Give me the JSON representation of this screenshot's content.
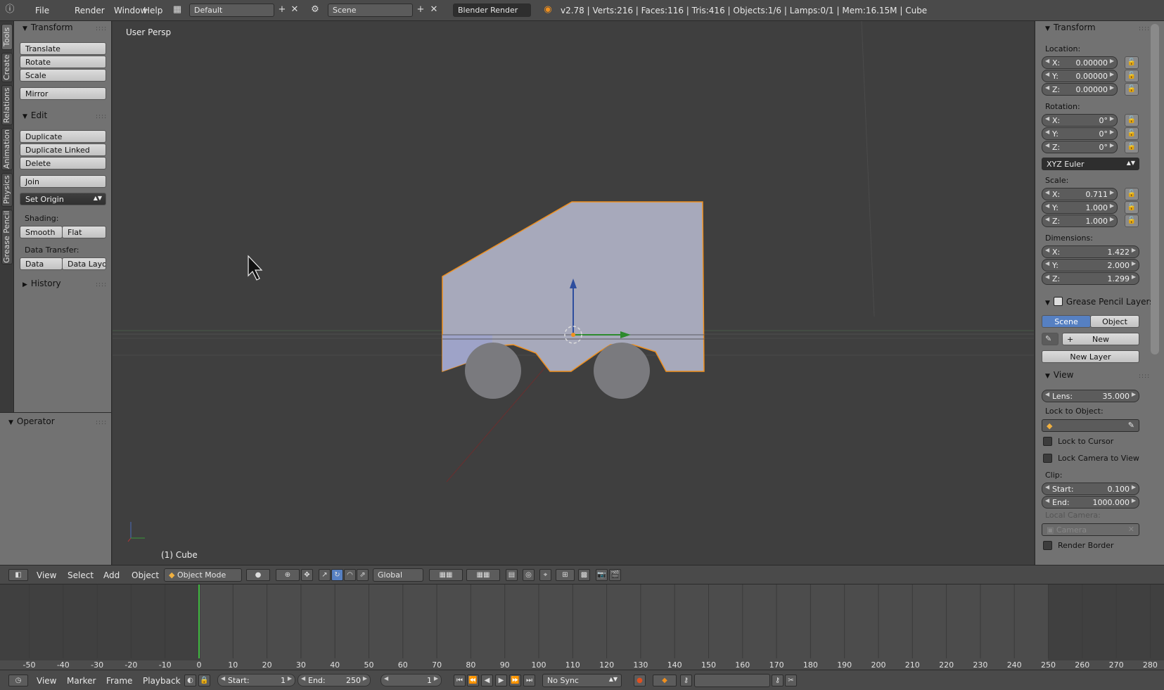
{
  "topbar": {
    "menus": [
      "File",
      "Render",
      "Window",
      "Help"
    ],
    "layout": "Default",
    "scene": "Scene",
    "engine": "Blender Render",
    "stats": "v2.78 | Verts:216 | Faces:116 | Tris:416 | Objects:1/6 | Lamps:0/1 | Mem:16.15M | Cube"
  },
  "left_tabs": [
    "Tools",
    "Create",
    "Relations",
    "Animation",
    "Physics",
    "Grease Pencil"
  ],
  "toolshelf": {
    "transform_title": "Transform",
    "transform_buttons": [
      "Translate",
      "Rotate",
      "Scale"
    ],
    "mirror": "Mirror",
    "edit_title": "Edit",
    "edit_buttons": [
      "Duplicate",
      "Duplicate Linked",
      "Delete"
    ],
    "join": "Join",
    "set_origin": "Set Origin",
    "shading_label": "Shading:",
    "smooth": "Smooth",
    "flat": "Flat",
    "data_transfer_label": "Data Transfer:",
    "data": "Data",
    "data_layout": "Data Layo",
    "history_title": "History",
    "operator_title": "Operator"
  },
  "viewport": {
    "view_name": "User Persp",
    "object_label": "(1) Cube"
  },
  "properties": {
    "transform_title": "Transform",
    "location_label": "Location:",
    "location": [
      {
        "k": "X:",
        "v": "0.00000"
      },
      {
        "k": "Y:",
        "v": "0.00000"
      },
      {
        "k": "Z:",
        "v": "0.00000"
      }
    ],
    "rotation_label": "Rotation:",
    "rotation": [
      {
        "k": "X:",
        "v": "0°"
      },
      {
        "k": "Y:",
        "v": "0°"
      },
      {
        "k": "Z:",
        "v": "0°"
      }
    ],
    "rotation_mode": "XYZ Euler",
    "scale_label": "Scale:",
    "scale": [
      {
        "k": "X:",
        "v": "0.711"
      },
      {
        "k": "Y:",
        "v": "1.000"
      },
      {
        "k": "Z:",
        "v": "1.000"
      }
    ],
    "dimensions_label": "Dimensions:",
    "dimensions": [
      {
        "k": "X:",
        "v": "1.422"
      },
      {
        "k": "Y:",
        "v": "2.000"
      },
      {
        "k": "Z:",
        "v": "1.299"
      }
    ],
    "grease_title": "Grease Pencil Layers",
    "gp_scene": "Scene",
    "gp_object": "Object",
    "gp_new": "New",
    "gp_new_layer": "New Layer",
    "view_title": "View",
    "lens_label": "Lens:",
    "lens_value": "35.000",
    "lock_to_object": "Lock to Object:",
    "lock_to_cursor": "Lock to Cursor",
    "lock_camera": "Lock Camera to View",
    "clip_label": "Clip:",
    "clip_start_label": "Start:",
    "clip_start": "0.100",
    "clip_end_label": "End:",
    "clip_end": "1000.000",
    "local_camera_label": "Local Camera:",
    "camera": "Camera",
    "render_border": "Render Border"
  },
  "view_header": {
    "menus": [
      "View",
      "Select",
      "Add",
      "Object"
    ],
    "mode": "Object Mode",
    "orientation": "Global"
  },
  "timeline": {
    "ticks": [
      "-50",
      "-40",
      "-30",
      "-20",
      "-10",
      "0",
      "10",
      "20",
      "30",
      "40",
      "50",
      "60",
      "70",
      "80",
      "90",
      "100",
      "110",
      "120",
      "130",
      "140",
      "150",
      "160",
      "170",
      "180",
      "190",
      "200",
      "210",
      "220",
      "230",
      "240",
      "250",
      "260",
      "270",
      "280"
    ],
    "menus": [
      "View",
      "Marker",
      "Frame",
      "Playback"
    ],
    "start_label": "Start:",
    "start": "1",
    "end_label": "End:",
    "end": "250",
    "current": "1",
    "sync": "No Sync"
  },
  "colors": {
    "accent": "#5680c2",
    "selection": "#f0901e",
    "playhead": "#3fb83f"
  }
}
